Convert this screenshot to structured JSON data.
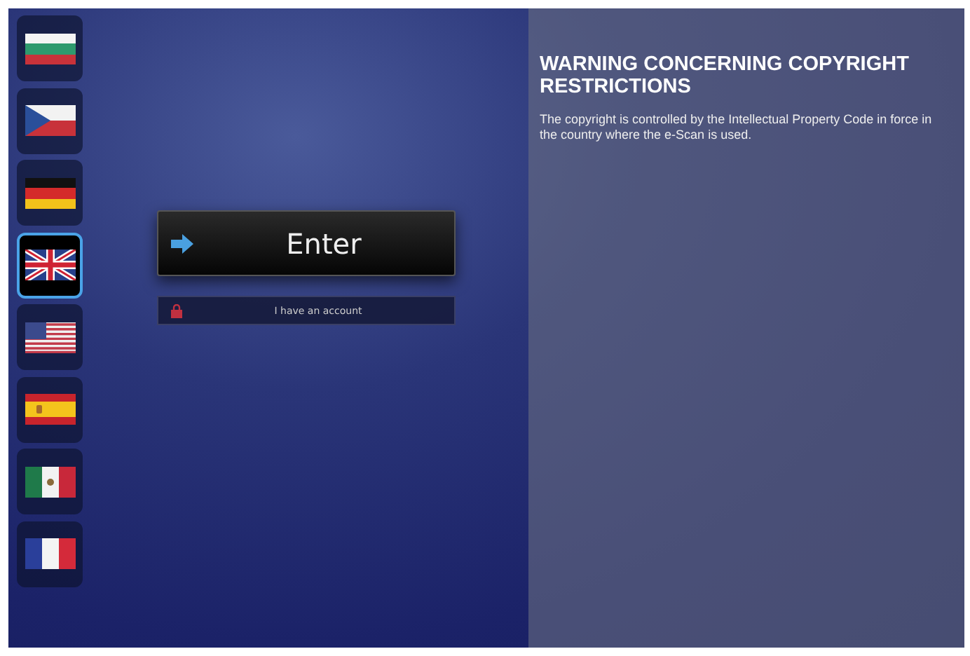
{
  "languages": [
    {
      "kind": "bulgaria",
      "selected": false
    },
    {
      "kind": "czech",
      "selected": false
    },
    {
      "kind": "germany",
      "selected": false
    },
    {
      "kind": "uk",
      "selected": true
    },
    {
      "kind": "usa",
      "selected": false
    },
    {
      "kind": "spain",
      "selected": false
    },
    {
      "kind": "mexico",
      "selected": false
    },
    {
      "kind": "france",
      "selected": false
    }
  ],
  "enter_button": {
    "label": "Enter"
  },
  "account_button": {
    "label": "I have an account"
  },
  "notice": {
    "title": "WARNING CONCERNING COPYRIGHT RESTRICTIONS",
    "body": "The copyright is controlled by the Intellectual Property Code in force in the country where the e-Scan is used."
  }
}
